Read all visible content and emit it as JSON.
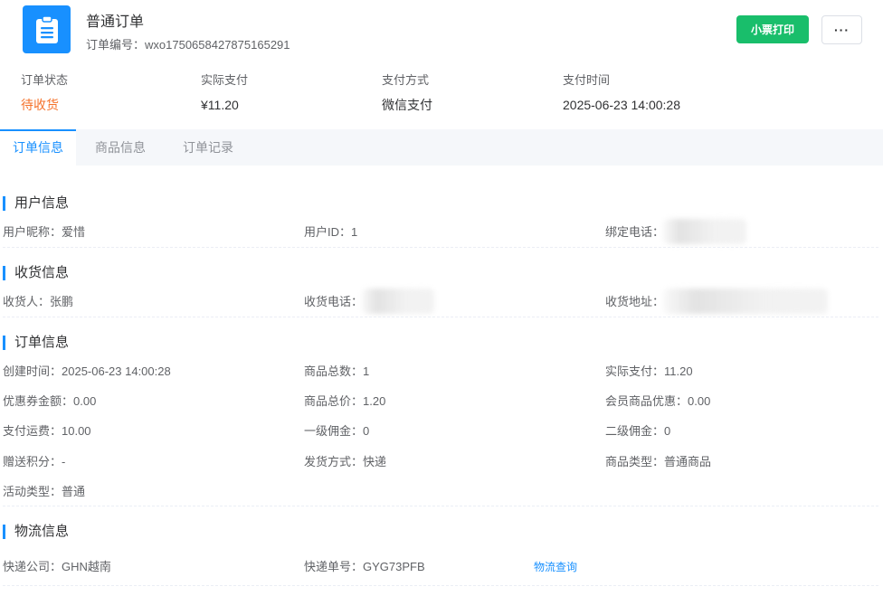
{
  "header": {
    "icon": "clipboard-icon",
    "title": "普通订单",
    "order_no_label": "订单编号：",
    "order_no": "wxo1750658427875165291",
    "print_button": "小票打印",
    "more_button": "···"
  },
  "summary": [
    {
      "label": "订单状态",
      "value": "待收货"
    },
    {
      "label": "实际支付",
      "value": "¥11.20"
    },
    {
      "label": "支付方式",
      "value": "微信支付"
    },
    {
      "label": "支付时间",
      "value": "2025-06-23 14:00:28"
    }
  ],
  "colors": {
    "accent": "#1890ff",
    "print_button": "#19be6b",
    "status_warn": "#f5722b"
  },
  "tabs": [
    {
      "label": "订单信息",
      "active": true
    },
    {
      "label": "商品信息",
      "active": false
    },
    {
      "label": "订单记录",
      "active": false
    }
  ],
  "user_info": {
    "title": "用户信息",
    "nickname": "用户昵称：爱惜",
    "user_id": "用户ID：1",
    "phone_label": "绑定电话："
  },
  "receiver_info": {
    "title": "收货信息",
    "name": "收货人：张鹏",
    "phone_label": "收货电话：",
    "address_label": "收货地址："
  },
  "order_info": {
    "title": "订单信息",
    "created": "创建时间：2025-06-23 14:00:28",
    "goods_count": "商品总数：1",
    "actual_paid": "实际支付：11.20",
    "coupon": "优惠券金额：0.00",
    "goods_total": "商品总价：1.20",
    "member_discount": "会员商品优惠：0.00",
    "shipping_fee": "支付运费：10.00",
    "commission_1": "一级佣金：0",
    "commission_2": "二级佣金：0",
    "points": "赠送积分：-",
    "delivery_method": "发货方式：快递",
    "goods_type": "商品类型：普通商品",
    "activity_type": "活动类型：普通"
  },
  "logistics_info": {
    "title": "物流信息",
    "company": "快递公司：GHN越南",
    "tracking_no": "快递单号：GYG73PFB",
    "query_link": "物流查询"
  }
}
